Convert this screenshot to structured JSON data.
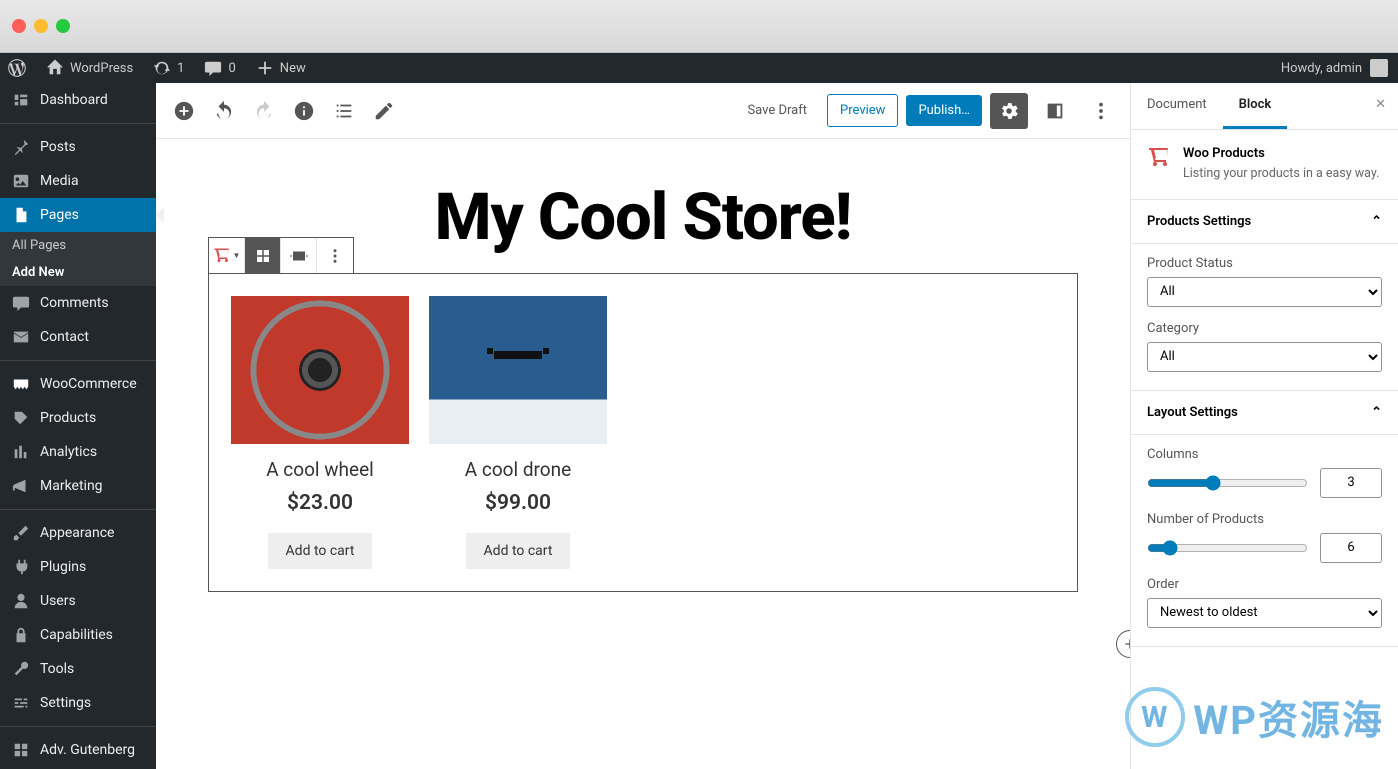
{
  "adminbar": {
    "site_name": "WordPress",
    "updates": "1",
    "comments": "0",
    "new_label": "New",
    "howdy": "Howdy, admin"
  },
  "sidebar": {
    "items": [
      {
        "label": "Dashboard"
      },
      {
        "label": "Posts"
      },
      {
        "label": "Media"
      },
      {
        "label": "Pages"
      },
      {
        "label": "Comments"
      },
      {
        "label": "Contact"
      },
      {
        "label": "WooCommerce"
      },
      {
        "label": "Products"
      },
      {
        "label": "Analytics"
      },
      {
        "label": "Marketing"
      },
      {
        "label": "Appearance"
      },
      {
        "label": "Plugins"
      },
      {
        "label": "Users"
      },
      {
        "label": "Capabilities"
      },
      {
        "label": "Tools"
      },
      {
        "label": "Settings"
      },
      {
        "label": "Adv. Gutenberg"
      }
    ],
    "pages_submenu": {
      "all": "All Pages",
      "add": "Add New"
    }
  },
  "toolbar": {
    "save_draft": "Save Draft",
    "preview": "Preview",
    "publish": "Publish…"
  },
  "page": {
    "title": "My Cool Store!"
  },
  "products": [
    {
      "name": "A cool wheel",
      "price": "$23.00",
      "button": "Add to cart"
    },
    {
      "name": "A cool drone",
      "price": "$99.00",
      "button": "Add to cart"
    }
  ],
  "inspector": {
    "tabs": {
      "document": "Document",
      "block": "Block"
    },
    "block_title": "Woo Products",
    "block_desc": "Listing your products in a easy way.",
    "panels": {
      "products_settings": "Products Settings",
      "product_status": "Product Status",
      "status_value": "All",
      "category": "Category",
      "category_value": "All",
      "layout_settings": "Layout Settings",
      "columns": "Columns",
      "columns_value": "3",
      "num_products": "Number of Products",
      "num_products_value": "6",
      "order": "Order",
      "order_value": "Newest to oldest"
    }
  },
  "watermark": "WP资源海"
}
